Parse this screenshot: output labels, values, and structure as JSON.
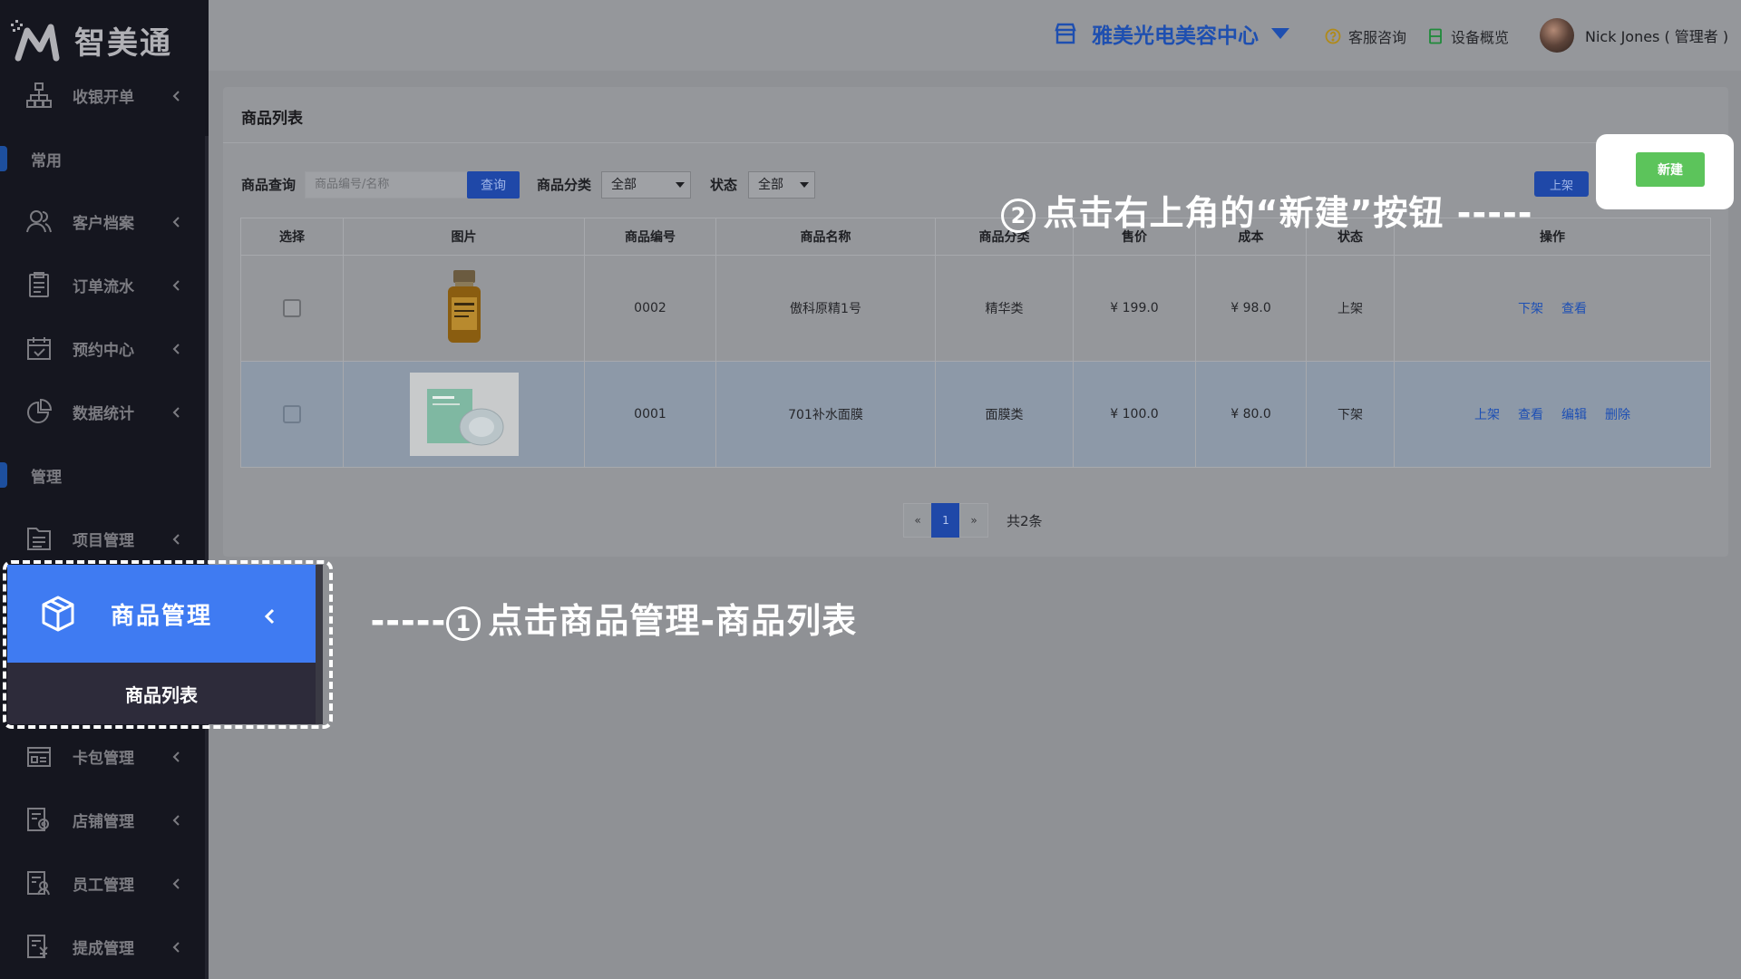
{
  "app": {
    "logo_text": "智美通"
  },
  "sidebar": {
    "items": [
      {
        "label": "收银开单"
      },
      {
        "label": "客户档案"
      },
      {
        "label": "订单流水"
      },
      {
        "label": "预约中心"
      },
      {
        "label": "数据统计"
      },
      {
        "label": "项目管理"
      },
      {
        "label": "商品管理"
      },
      {
        "label": "卡包管理"
      },
      {
        "label": "店铺管理"
      },
      {
        "label": "员工管理"
      },
      {
        "label": "提成管理"
      }
    ],
    "sections": [
      {
        "label": "常用"
      },
      {
        "label": "管理"
      }
    ],
    "submenu": {
      "label": "商品列表"
    }
  },
  "header": {
    "store_name": "雅美光电美容中心",
    "service_label": "客服咨询",
    "device_label": "设备概览",
    "user_name": "Nick Jones ( 管理者 )"
  },
  "card": {
    "title": "商品列表",
    "filters": {
      "query_label": "商品查询",
      "query_placeholder": "商品编号/名称",
      "query_button": "查询",
      "category_label": "商品分类",
      "category_value": "全部",
      "status_label": "状态",
      "status_value": "全部"
    },
    "onshelf_button": "上架",
    "new_button": "新建"
  },
  "table": {
    "headers": [
      "选择",
      "图片",
      "商品编号",
      "商品名称",
      "商品分类",
      "售价",
      "成本",
      "状态",
      "操作"
    ],
    "rows": [
      {
        "code": "0002",
        "name": "傲科原精1号",
        "category": "精华类",
        "price": "¥ 199.0",
        "cost": "¥ 98.0",
        "status": "上架",
        "actions": [
          "下架",
          "查看"
        ]
      },
      {
        "code": "0001",
        "name": "701补水面膜",
        "category": "面膜类",
        "price": "¥ 100.0",
        "cost": "¥ 80.0",
        "status": "下架",
        "actions": [
          "上架",
          "查看",
          "编辑",
          "删除"
        ]
      }
    ]
  },
  "pagination": {
    "prev": "«",
    "current": "1",
    "next": "»",
    "total": "共2条"
  },
  "annotations": {
    "step1_num": "1",
    "step1_text": "点击商品管理-商品列表",
    "step1_dash": "-----",
    "step2_num": "2",
    "step2_text": "点击右上角的“新建”按钮",
    "step2_dash": "-----"
  },
  "colors": {
    "accent": "#3f7bf2",
    "primary_dark": "#1f48a8",
    "new_button": "#5cc45b",
    "sidebar_bg": "#15161f",
    "overlay_bg": "#8f9195"
  }
}
